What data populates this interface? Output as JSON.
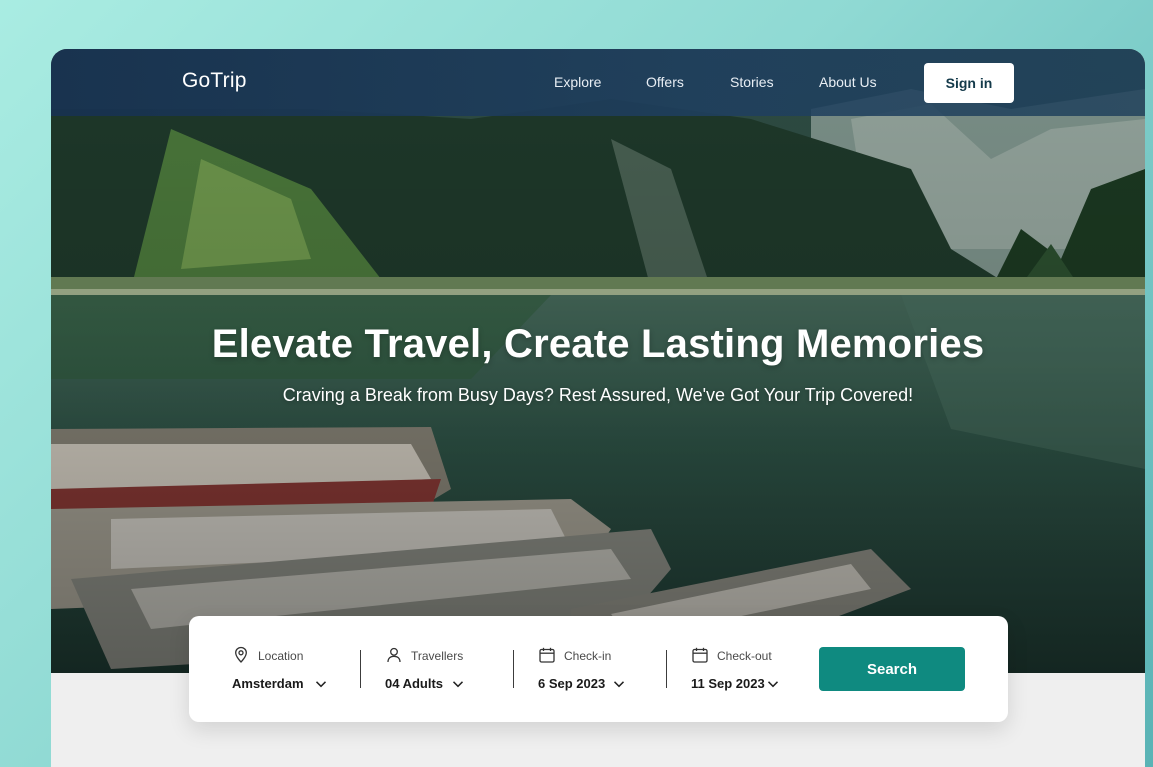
{
  "header": {
    "logo": "GoTrip",
    "nav": [
      "Explore",
      "Offers",
      "Stories",
      "About Us"
    ],
    "signin_label": "Sign in"
  },
  "hero": {
    "headline": "Elevate Travel, Create Lasting Memories",
    "subline": "Craving a Break from Busy Days? Rest Assured,  We've Got Your Trip Covered!"
  },
  "search": {
    "location": {
      "label": "Location",
      "value": "Amsterdam",
      "icon": "location-pin-icon"
    },
    "travellers": {
      "label": "Travellers",
      "value": "04 Adults",
      "icon": "user-icon"
    },
    "checkin": {
      "label": "Check-in",
      "value": "6 Sep 2023",
      "icon": "calendar-icon"
    },
    "checkout": {
      "label": "Check-out",
      "value": "11 Sep 2023",
      "icon": "calendar-icon"
    },
    "button_label": "Search"
  },
  "colors": {
    "accent": "#0f8a80",
    "header_bg": "#1d3d5c",
    "page_bg": "#9ee3dc"
  }
}
